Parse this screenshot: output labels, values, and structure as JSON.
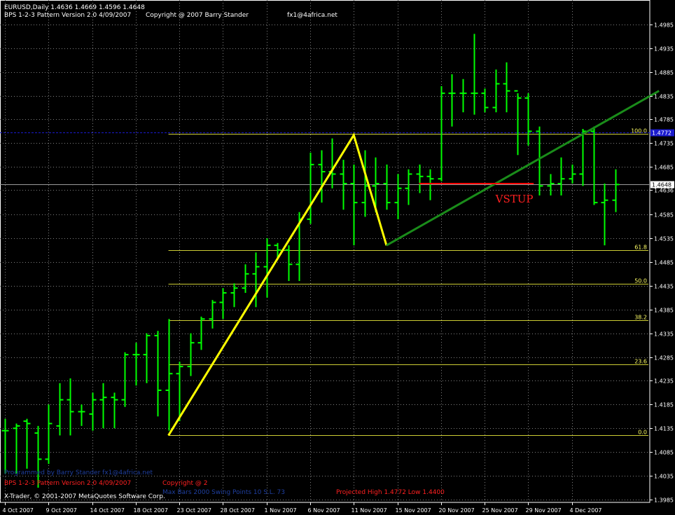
{
  "header": {
    "symbol_line": "EURUSD,Daily  1.4636 1.4669 1.4596 1.4648",
    "indicator_line": "BPS 1-2-3 Pattern  Version 2.0  4/09/2007",
    "copyright": "Copyright @ 2007 Barry Stander",
    "email": "fx1@4africa.net"
  },
  "footer": {
    "watermark": "Programmed by Barry Stander  fx1@4africa.net",
    "indicator_line": "BPS 1-2-3 Pattern  Version 2.0  4/09/2007",
    "copyright": "Copyright @ 2",
    "stats": "Max Bars  2000   Swing Points  10   S.L. 73",
    "projected": "Projected High   1.4772    Low   1.4400",
    "platform": "X-Trader, © 2001-2007 MetaQuotes Software Corp."
  },
  "annotation": "VSTUP",
  "colors": {
    "background": "#000000",
    "bar": "#00ff00",
    "pattern_line": "#ffff00",
    "trend_line": "#1a8c1a",
    "signal_line": "#ff0000",
    "fib_level": "#cccc33",
    "high_line": "#1a1acc",
    "current_price_tag": "#ffffff"
  },
  "chart_data": {
    "type": "ohlc",
    "ylim": [
      1.3985,
      1.4995
    ],
    "y_ticks": [
      "1.4985",
      "1.4935",
      "1.4885",
      "1.4835",
      "1.4785",
      "1.4735",
      "1.4685",
      "1.4636",
      "1.4585",
      "1.4535",
      "1.4485",
      "1.4435",
      "1.4385",
      "1.4335",
      "1.4285",
      "1.4235",
      "1.4185",
      "1.4135",
      "1.4085",
      "1.4035",
      "1.3985"
    ],
    "x_ticks": [
      {
        "label": "4 Oct 2007",
        "index": 0
      },
      {
        "label": "9 Oct 2007",
        "index": 4
      },
      {
        "label": "14 Oct 2007",
        "index": 8
      },
      {
        "label": "18 Oct 2007",
        "index": 12
      },
      {
        "label": "23 Oct 2007",
        "index": 16
      },
      {
        "label": "28 Oct 2007",
        "index": 20
      },
      {
        "label": "1 Nov 2007",
        "index": 24
      },
      {
        "label": "6 Nov 2007",
        "index": 28
      },
      {
        "label": "11 Nov 2007",
        "index": 32
      },
      {
        "label": "15 Nov 2007",
        "index": 36
      },
      {
        "label": "20 Nov 2007",
        "index": 40
      },
      {
        "label": "25 Nov 2007",
        "index": 44
      },
      {
        "label": "29 Nov 2007",
        "index": 48
      },
      {
        "label": "4 Dec 2007",
        "index": 52
      }
    ],
    "bars": [
      [
        1.413,
        1.4155,
        1.404,
        1.413
      ],
      [
        1.4135,
        1.4145,
        1.404,
        1.414
      ],
      [
        1.415,
        1.4155,
        1.405,
        1.4145
      ],
      [
        1.4125,
        1.414,
        1.401,
        1.407
      ],
      [
        1.407,
        1.4185,
        1.406,
        1.4145
      ],
      [
        1.414,
        1.423,
        1.412,
        1.4195
      ],
      [
        1.4195,
        1.424,
        1.412,
        1.417
      ],
      [
        1.417,
        1.4185,
        1.414,
        1.417
      ],
      [
        1.4165,
        1.421,
        1.413,
        1.4195
      ],
      [
        1.4195,
        1.423,
        1.4135,
        1.42
      ],
      [
        1.42,
        1.421,
        1.4135,
        1.4195
      ],
      [
        1.4195,
        1.4295,
        1.418,
        1.429
      ],
      [
        1.429,
        1.4315,
        1.4225,
        1.429
      ],
      [
        1.429,
        1.4335,
        1.423,
        1.433
      ],
      [
        1.433,
        1.434,
        1.416,
        1.4215
      ],
      [
        1.4215,
        1.4365,
        1.413,
        1.425
      ],
      [
        1.425,
        1.4275,
        1.415,
        1.4265
      ],
      [
        1.4265,
        1.4335,
        1.4245,
        1.4315
      ],
      [
        1.4315,
        1.437,
        1.43,
        1.4365
      ],
      [
        1.4365,
        1.4405,
        1.4345,
        1.44
      ],
      [
        1.44,
        1.443,
        1.4365,
        1.442
      ],
      [
        1.442,
        1.444,
        1.439,
        1.443
      ],
      [
        1.443,
        1.448,
        1.442,
        1.446
      ],
      [
        1.446,
        1.4505,
        1.439,
        1.4475
      ],
      [
        1.4475,
        1.4535,
        1.441,
        1.452
      ],
      [
        1.452,
        1.4525,
        1.449,
        1.451
      ],
      [
        1.451,
        1.452,
        1.4445,
        1.448
      ],
      [
        1.448,
        1.459,
        1.4445,
        1.4575
      ],
      [
        1.4575,
        1.4715,
        1.4565,
        1.469
      ],
      [
        1.469,
        1.472,
        1.461,
        1.4675
      ],
      [
        1.4675,
        1.4745,
        1.464,
        1.467
      ],
      [
        1.467,
        1.47,
        1.4595,
        1.465
      ],
      [
        1.465,
        1.469,
        1.452,
        1.461
      ],
      [
        1.461,
        1.472,
        1.458,
        1.4645
      ],
      [
        1.4645,
        1.4705,
        1.459,
        1.465
      ],
      [
        1.465,
        1.469,
        1.4595,
        1.461
      ],
      [
        1.461,
        1.467,
        1.4575,
        1.464
      ],
      [
        1.464,
        1.468,
        1.4605,
        1.467
      ],
      [
        1.467,
        1.469,
        1.463,
        1.4665
      ],
      [
        1.4665,
        1.468,
        1.4615,
        1.466
      ],
      [
        1.466,
        1.4855,
        1.4655,
        1.484
      ],
      [
        1.484,
        1.488,
        1.477,
        1.484
      ],
      [
        1.484,
        1.487,
        1.48,
        1.484
      ],
      [
        1.484,
        1.4965,
        1.4795,
        1.484
      ],
      [
        1.484,
        1.485,
        1.48,
        1.481
      ],
      [
        1.481,
        1.489,
        1.48,
        1.486
      ],
      [
        1.486,
        1.4905,
        1.48,
        1.4845
      ],
      [
        1.4845,
        1.484,
        1.471,
        1.483
      ],
      [
        1.483,
        1.484,
        1.473,
        1.476
      ],
      [
        1.476,
        1.477,
        1.4625,
        1.4645
      ],
      [
        1.4645,
        1.467,
        1.4625,
        1.465
      ],
      [
        1.465,
        1.4705,
        1.4625,
        1.466
      ],
      [
        1.466,
        1.469,
        1.465,
        1.467
      ],
      [
        1.467,
        1.4765,
        1.4645,
        1.476
      ],
      [
        1.476,
        1.477,
        1.4605,
        1.461
      ],
      [
        1.461,
        1.465,
        1.452,
        1.4615
      ],
      [
        1.4615,
        1.468,
        1.459,
        1.4648
      ]
    ],
    "bar_x_first": 7,
    "bar_x_step": 15.57,
    "fib_levels": [
      {
        "label": "100.0",
        "price": 1.4755
      },
      {
        "label": "61.8",
        "price": 1.451
      },
      {
        "label": "50.0",
        "price": 1.4439
      },
      {
        "label": "38.2",
        "price": 1.4363
      },
      {
        "label": "23.6",
        "price": 1.427
      },
      {
        "label": "0.0",
        "price": 1.412
      }
    ],
    "pattern_points": [
      {
        "index": 15,
        "price": 1.412
      },
      {
        "index": 32,
        "price": 1.4752
      },
      {
        "index": 35,
        "price": 1.452
      }
    ],
    "trend_line": [
      {
        "index": 35,
        "price": 1.452
      },
      {
        "index": 60,
        "price": 1.4845
      }
    ],
    "signal_line": {
      "from_index": 38,
      "to_index": 48.5,
      "price": 1.465
    },
    "annotation_anchor": {
      "index": 45,
      "price": 1.461
    },
    "high_price_line": 1.4758,
    "high_price_tag": "1.4772",
    "current_price_line": 1.4648,
    "current_price_tag": "1.4648"
  }
}
